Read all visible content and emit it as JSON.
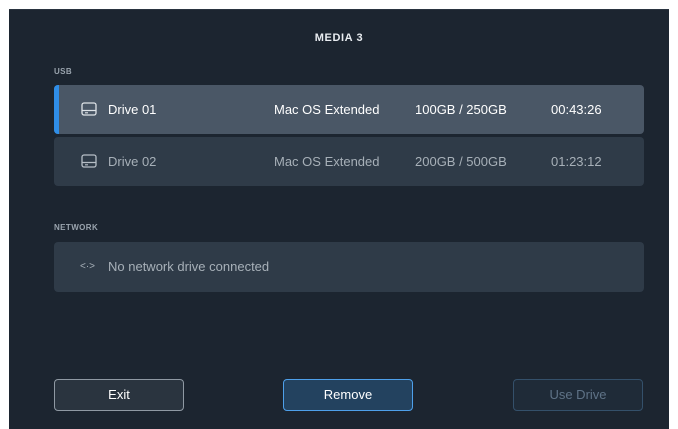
{
  "header": {
    "title": "MEDIA 3"
  },
  "usb": {
    "section_label": "USB",
    "drives": [
      {
        "name": "Drive 01",
        "format": "Mac OS Extended",
        "capacity": "100GB / 250GB",
        "time": "00:43:26",
        "selected": true
      },
      {
        "name": "Drive 02",
        "format": "Mac OS Extended",
        "capacity": "200GB / 500GB",
        "time": "01:23:12",
        "selected": false
      }
    ]
  },
  "network": {
    "section_label": "NETWORK",
    "icon": "network-arrows-icon",
    "empty_message": "No network drive connected"
  },
  "footer": {
    "exit_label": "Exit",
    "remove_label": "Remove",
    "use_drive_label": "Use Drive"
  },
  "colors": {
    "background": "#1c2530",
    "row": "#2f3b48",
    "row_selected": "#4a5766",
    "accent": "#2f8ee8"
  }
}
